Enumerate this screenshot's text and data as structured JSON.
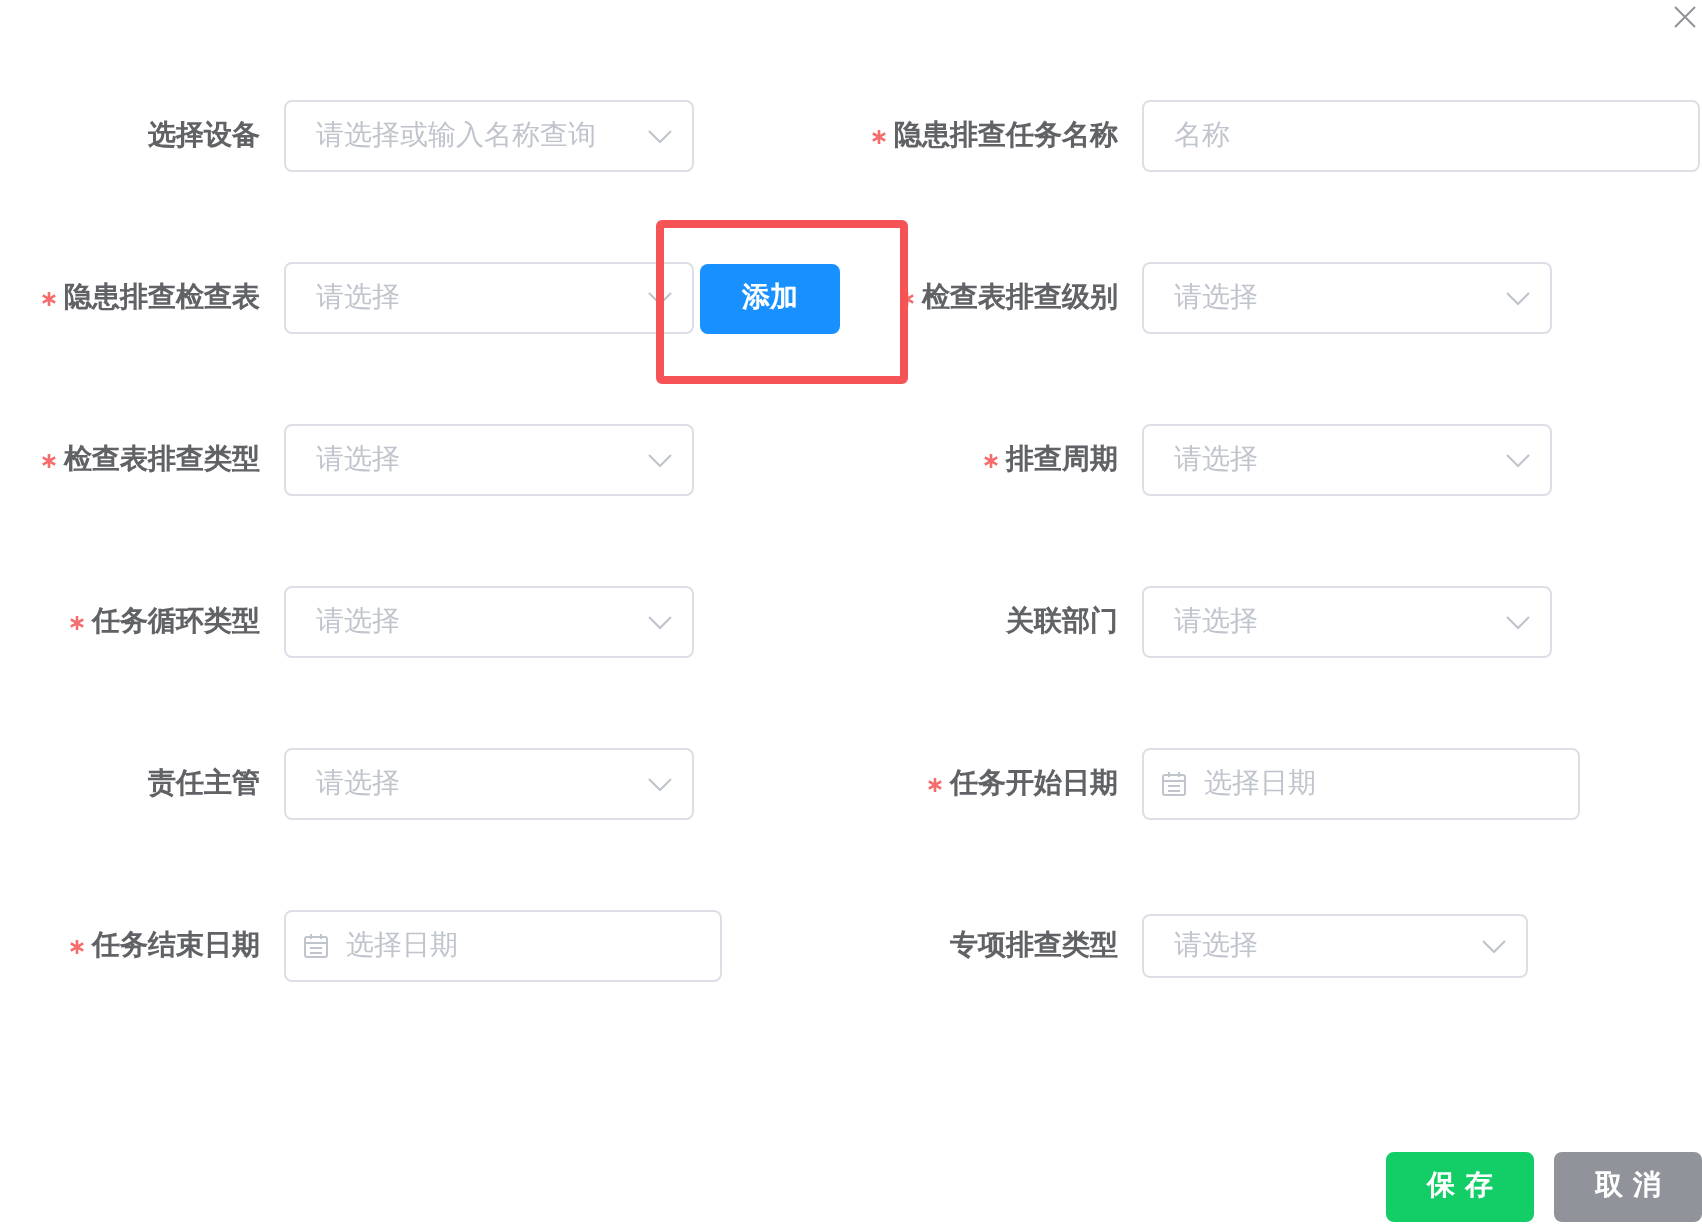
{
  "form": {
    "fields": [
      {
        "label": "选择设备",
        "required": false,
        "kind": "select",
        "placeholder": "请选择或输入名称查询"
      },
      {
        "label": "隐患排查任务名称",
        "required": true,
        "kind": "input",
        "placeholder": "名称"
      },
      {
        "label": "隐患排查检查表",
        "required": true,
        "kind": "select",
        "placeholder": "请选择",
        "button": {
          "label": "添加",
          "highlighted": true
        }
      },
      {
        "label": "检查表排查级别",
        "required": true,
        "kind": "select",
        "placeholder": "请选择"
      },
      {
        "label": "检查表排查类型",
        "required": true,
        "kind": "select",
        "placeholder": "请选择"
      },
      {
        "label": "排查周期",
        "required": true,
        "kind": "select",
        "placeholder": "请选择"
      },
      {
        "label": "任务循环类型",
        "required": true,
        "kind": "select",
        "placeholder": "请选择"
      },
      {
        "label": "关联部门",
        "required": false,
        "kind": "select",
        "placeholder": "请选择"
      },
      {
        "label": "责任主管",
        "required": false,
        "kind": "select",
        "placeholder": "请选择"
      },
      {
        "label": "任务开始日期",
        "required": true,
        "kind": "date",
        "placeholder": "选择日期"
      },
      {
        "label": "任务结束日期",
        "required": true,
        "kind": "date",
        "placeholder": "选择日期"
      },
      {
        "label": "专项排查类型",
        "required": false,
        "kind": "select",
        "placeholder": "请选择"
      }
    ]
  },
  "footer": {
    "buttons": [
      {
        "label": "保存",
        "kind": "save"
      },
      {
        "label": "取消",
        "kind": "cancel"
      }
    ]
  }
}
